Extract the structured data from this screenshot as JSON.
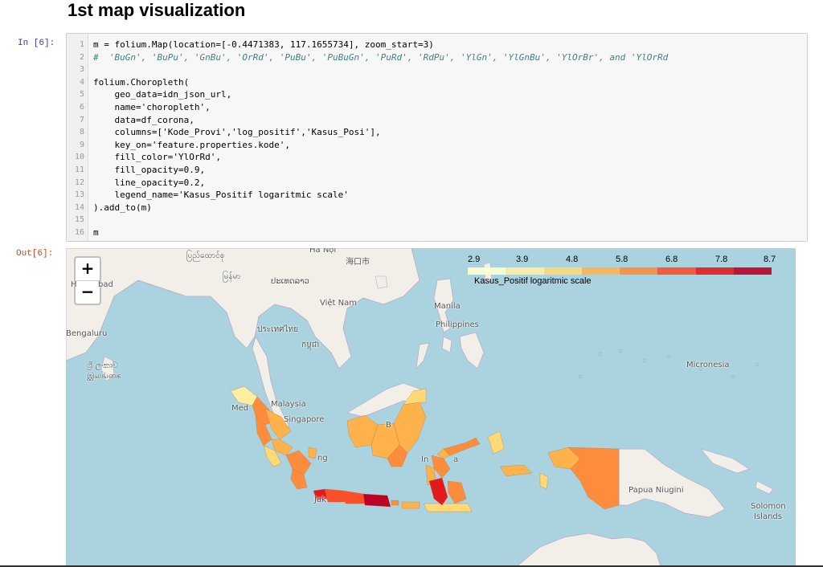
{
  "heading": "1st map visualization",
  "prompts": {
    "in": "In [6]:",
    "out": "Out[6]:"
  },
  "code_lines": [
    "m = folium.Map(location=[-0.4471383, 117.1655734], zoom_start=3)",
    "#  'BuGn', 'BuPu', 'GnBu', 'OrRd', 'PuBu', 'PuBuGn', 'PuRd', 'RdPu', 'YlGn', 'YlGnBu', 'YlOrBr', and 'YlOrRd",
    "",
    "folium.Choropleth(",
    "    geo_data=idn_json_url,",
    "    name='choropleth',",
    "    data=df_corona,",
    "    columns=['Kode_Provi','log_positif','Kasus_Posi'],",
    "    key_on='feature.properties.kode',",
    "    fill_color='YlOrRd',",
    "    fill_opacity=0.9,",
    "    line_opacity=0.2,",
    "    legend_name='Kasus_Positif logaritmic scale'",
    ").add_to(m)",
    "",
    "m"
  ],
  "line_numbers": [
    "1",
    "2",
    "3",
    "4",
    "5",
    "6",
    "7",
    "8",
    "9",
    "10",
    "11",
    "12",
    "13",
    "14",
    "15",
    "16"
  ],
  "map": {
    "zoom_in": "+",
    "zoom_out": "−",
    "legend": {
      "ticks": [
        "2.9",
        "3.9",
        "4.8",
        "5.8",
        "6.8",
        "7.8",
        "8.7"
      ],
      "caption": "Kasus_Positif logaritmic scale",
      "colors": [
        "#ffffcc",
        "#ffeda0",
        "#fed976",
        "#feb24c",
        "#fd8d3c",
        "#fc4e2a",
        "#e31a1c",
        "#bd0026"
      ]
    },
    "labels": {
      "myanmar": "ပြည်ထောင်စု",
      "hanoi": "Hà Nội",
      "hainan": "海口市",
      "hyderabad_a": "H",
      "hyderabad_b": "bad",
      "yangon": "မြန်မာ",
      "laos": "ປະເທດລາວ",
      "vietnam": "Việt Nam",
      "bengaluru": "Bengaluru",
      "thailand": "ประเทศไทย",
      "manila": "Manila",
      "philippines": "Philippines",
      "cambodia": "កម្ពុជា",
      "srilanka1": "ශ්‍රී ලංකාව",
      "srilanka2": "இலங்கை",
      "micronesia": "Micronesia",
      "malaysia": "Malaysia",
      "medan": "Med",
      "singapore": "Singapore",
      "indonesia_a": "In",
      "indonesia_b": "a",
      "papua": "Papua Niugini",
      "solomon1": "Solomon",
      "solomon2": "Islands",
      "jakarta": "Jak",
      "palembang": "ng",
      "borneo": "B"
    }
  }
}
